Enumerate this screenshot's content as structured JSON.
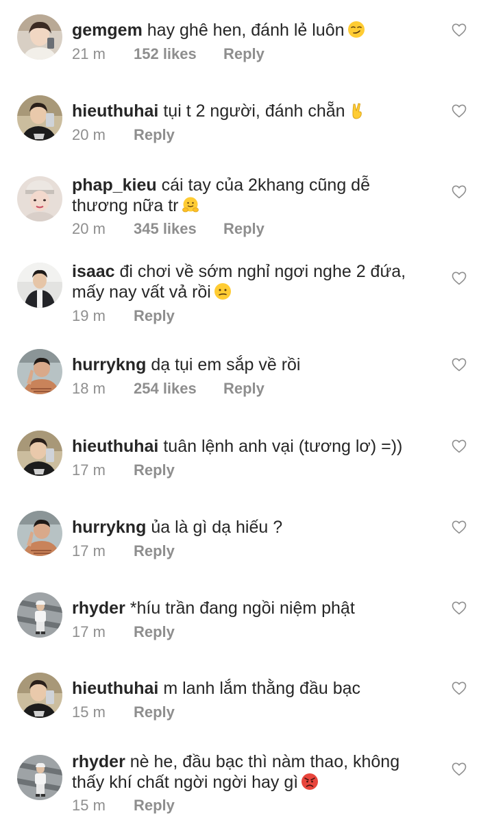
{
  "comments": [
    {
      "username": "gemgem",
      "text": "hay ghê hen, đánh lẻ luôn",
      "emoji": "smirk-emoji",
      "time": "21 m",
      "likes": "152 likes",
      "reply": "Reply"
    },
    {
      "username": "hieuthuhai",
      "text": "tụi t 2 người, đánh chẵn",
      "emoji": "victory-hand-emoji",
      "time": "20 m",
      "likes": "",
      "reply": "Reply"
    },
    {
      "username": "phap_kieu",
      "text": "cái tay của 2khang cũng dễ thương nữa tr",
      "emoji": "hugging-face-emoji",
      "time": "20 m",
      "likes": "345 likes",
      "reply": "Reply"
    },
    {
      "username": "isaac",
      "text": "đi chơi về sớm nghỉ ngơi nghe 2 đứa, mấy nay vất vả rồi",
      "emoji": "confused-face-emoji",
      "time": "19 m",
      "likes": "",
      "reply": "Reply"
    },
    {
      "username": "hurrykng",
      "text": "dạ tụi em sắp về rồi",
      "emoji": "",
      "time": "18 m",
      "likes": "254 likes",
      "reply": "Reply"
    },
    {
      "username": "hieuthuhai",
      "text": "tuân lệnh anh vại (tương lơ) =))",
      "emoji": "",
      "time": "17 m",
      "likes": "",
      "reply": "Reply"
    },
    {
      "username": "hurrykng",
      "text": "ủa là gì dạ hiếu ?",
      "emoji": "",
      "time": "17 m",
      "likes": "",
      "reply": "Reply"
    },
    {
      "username": "rhyder",
      "text": "*híu trần đang ngồi niệm phật",
      "emoji": "",
      "time": "17 m",
      "likes": "",
      "reply": "Reply"
    },
    {
      "username": "hieuthuhai",
      "text": "m lanh lắm thằng đầu bạc",
      "emoji": "",
      "time": "15 m",
      "likes": "",
      "reply": "Reply"
    },
    {
      "username": "rhyder",
      "text": "nè he, đầu bạc thì nàm thao, không thấy khí chất ngời ngời hay gì",
      "emoji": "angry-face-emoji",
      "time": "15 m",
      "likes": "",
      "reply": "Reply"
    }
  ],
  "icons": {
    "like": "heart-outline-icon"
  },
  "colors": {
    "text": "#262626",
    "meta": "#8e8e8e",
    "heart": "#8e8e8e",
    "emoji_yellow": "#ffcc33",
    "emoji_red": "#e8453c"
  }
}
